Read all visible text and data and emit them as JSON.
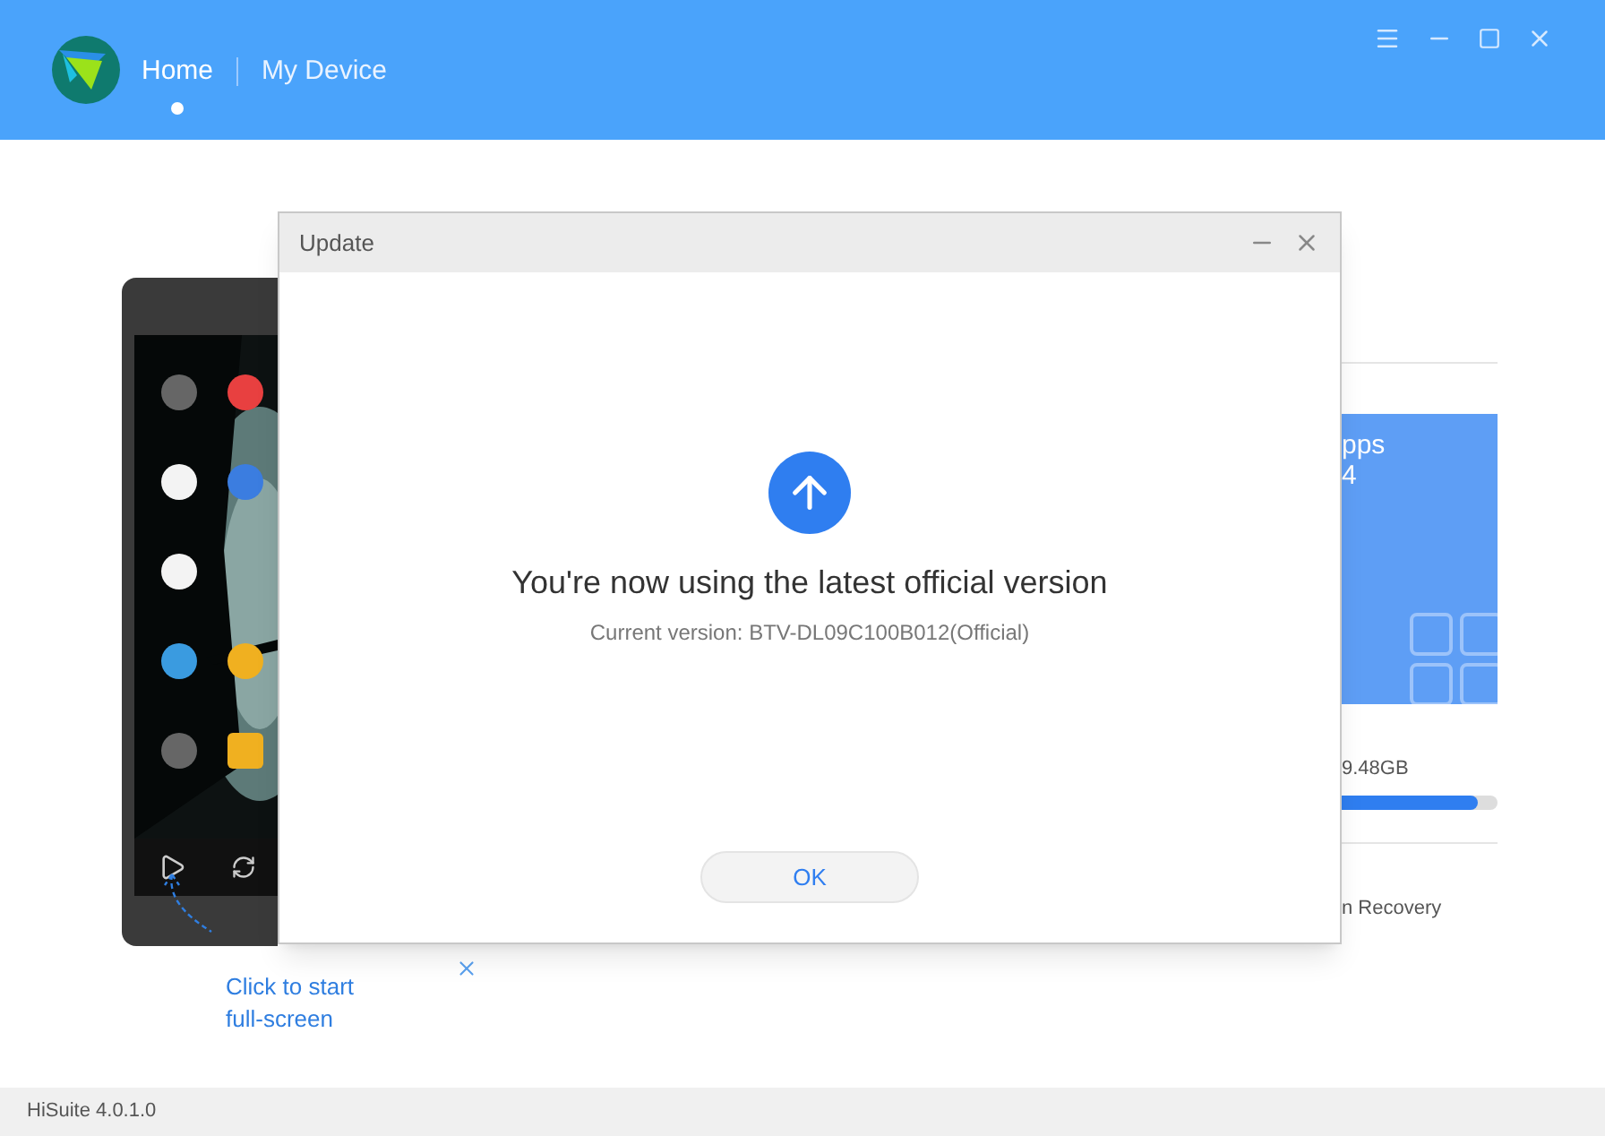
{
  "header": {
    "nav": [
      {
        "label": "Home",
        "selected": true
      },
      {
        "label": "My Device",
        "selected": false
      }
    ]
  },
  "device_preview": {
    "hint": "Click to start full-screen"
  },
  "apps_tile": {
    "label": "pps",
    "count": "4"
  },
  "storage": {
    "reading": "9.48GB",
    "level": 0.87
  },
  "recovery_link": "n Recovery",
  "dialog": {
    "title": "Update",
    "heading": "You're now using the latest official version",
    "version": "Current version: BTV-DL09C100B012(Official)",
    "button": "OK"
  },
  "status_bar": "HiSuite 4.0.1.0"
}
